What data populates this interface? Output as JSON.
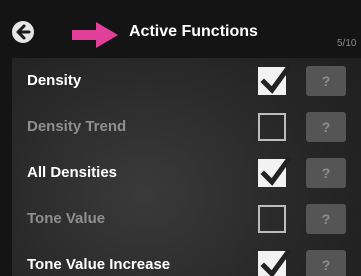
{
  "header": {
    "title": "Active Functions",
    "page_counter": "5/10"
  },
  "functions": [
    {
      "label": "Density",
      "checked": true,
      "help": "?"
    },
    {
      "label": "Density Trend",
      "checked": false,
      "help": "?"
    },
    {
      "label": "All Densities",
      "checked": true,
      "help": "?"
    },
    {
      "label": "Tone Value",
      "checked": false,
      "help": "?"
    },
    {
      "label": "Tone Value Increase",
      "checked": true,
      "help": "?"
    }
  ],
  "colors": {
    "accent_arrow": "#e0409a",
    "header_bg": "#141414",
    "checkbox_fill": "#f2f2f2"
  },
  "icons": {
    "back": "back-arrow-icon",
    "indicator": "pink-arrow-icon",
    "check": "checkmark-icon"
  }
}
